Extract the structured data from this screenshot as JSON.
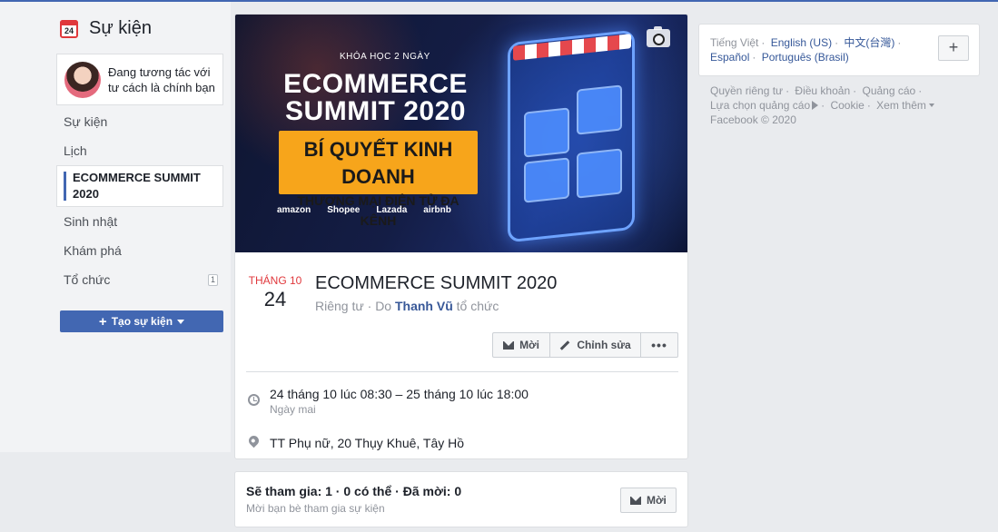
{
  "left_nav": {
    "title": "Sự kiện",
    "calendar_icon_day": "24",
    "acting_as": "Đang tương tác với tư cách là chính bạn",
    "items": [
      {
        "label": "Sự kiện"
      },
      {
        "label": "Lịch"
      },
      {
        "label": "ECOMMERCE SUMMIT 2020"
      },
      {
        "label": "Sinh nhật"
      },
      {
        "label": "Khám phá"
      },
      {
        "label": "Tổ chức",
        "badge": "1"
      }
    ],
    "create_button": "Tạo sự kiện"
  },
  "cover": {
    "small_text": "KHÓA HỌC 2 NGÀY",
    "headline": "ECOMMERCE SUMMIT 2020",
    "banner_line1": "BÍ QUYẾT KINH DOANH",
    "banner_line2": "THƯƠNG MẠI ĐIỆN TỬ ĐA KÊNH",
    "brands": [
      "amazon",
      "Shopee",
      "Lazada",
      "airbnb"
    ]
  },
  "event": {
    "month": "THÁNG 10",
    "day": "24",
    "title": "ECOMMERCE SUMMIT 2020",
    "privacy": "Riêng tư",
    "organizer_prefix": "Do",
    "organizer": "Thanh Vũ",
    "organizer_suffix": "tổ chức",
    "actions": {
      "invite": "Mời",
      "edit": "Chỉnh sửa",
      "more": "•••"
    },
    "time": "24 tháng 10 lúc 08:30 – 25 tháng 10 lúc 18:00",
    "time_relative": "Ngày mai",
    "location": "TT Phụ nữ, 20 Thụy Khuê, Tây Hồ"
  },
  "guests": {
    "stats": "Sẽ tham gia: 1 · 0 có thể · Đã mời: 0",
    "hint": "Mời bạn bè tham gia sự kiện",
    "invite": "Mời"
  },
  "languages": {
    "items": [
      "Tiếng Việt",
      "English (US)",
      "中文(台灣)",
      "Español",
      "Português (Brasil)"
    ],
    "add": "+"
  },
  "footer": {
    "links": [
      "Quyền riêng tư",
      "Điều khoản",
      "Quảng cáo",
      "Lựa chọn quảng cáo",
      "Cookie",
      "Xem thêm"
    ],
    "copyright": "Facebook © 2020"
  },
  "colors": {
    "accent": "#4267b2",
    "date_red": "#e0383c",
    "link": "#385898"
  }
}
